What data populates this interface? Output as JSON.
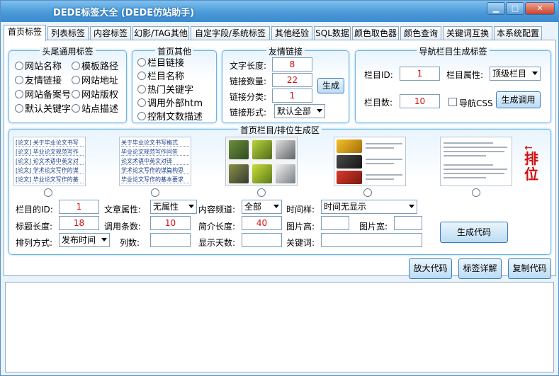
{
  "window": {
    "title": "DEDE标签大全 (DEDE仿站助手)"
  },
  "tabs": [
    "首页标签",
    "列表标签",
    "内容标签",
    "幻影/TAG其他",
    "自定字段/系统标签",
    "其他经验",
    "SQL数据",
    "颜色取色器",
    "颜色查询",
    "关键词互换",
    "本系统配置"
  ],
  "header_tags": {
    "caption": "头尾通用标签",
    "items": [
      "网站名称",
      "模板路径",
      "友情链接",
      "网站地址",
      "网站备案号",
      "网站版权",
      "默认关键字",
      "站点描述"
    ]
  },
  "home_other": {
    "caption": "首页其他",
    "items": [
      "栏目链接",
      "栏目名称",
      "热门关键字",
      "调用外部htm",
      "控制文数描述"
    ]
  },
  "friend_links": {
    "caption": "友情链接",
    "text_length_label": "文字长度:",
    "text_length": "8",
    "link_count_label": "链接数量:",
    "link_count": "22",
    "link_category_label": "链接分类:",
    "link_category": "1",
    "link_form_label": "链接形式:",
    "link_form": "默认全部",
    "generate_label": "生成"
  },
  "nav_tags": {
    "caption": "导航栏目生成标签",
    "column_id_label": "栏目ID:",
    "column_id": "1",
    "column_attr_label": "栏目属性:",
    "column_attr": "顶级栏目",
    "column_count_label": "栏目数:",
    "column_count": "10",
    "nav_css_label": "导航CSS",
    "generate_call_label": "生成调用"
  },
  "home_column": {
    "caption": "首页栏目/排位生成区",
    "list_lines_a": [
      "[论文] 关于毕业论文书写",
      "[论文] 毕业论文规范写作",
      "[论文] 论文术语中英文对",
      "[论文] 学术论文写作的谋",
      "[论文] 毕业论文写作的基"
    ],
    "list_lines_b": [
      "关于毕业论文书写格式",
      "毕业论文规范写作问答",
      "论文术语中英文对译",
      "学术论文写作的谋篇构思",
      "毕业论文写作的基本要求"
    ],
    "side_label": "排位",
    "column_id_label": "栏目的ID:",
    "column_id": "1",
    "article_attr_label": "文章属性:",
    "article_attr": "无属性",
    "channel_label": "内容频道:",
    "channel": "全部",
    "time_style_label": "时间样:",
    "time_style": "时间无显示",
    "title_length_label": "标题长度:",
    "title_length": "18",
    "call_count_label": "调用条数:",
    "call_count": "10",
    "intro_length_label": "简介长度:",
    "intro_length": "40",
    "img_height_label": "图片高:",
    "img_height": "",
    "img_width_label": "图片宽:",
    "img_width": "",
    "sort_label": "排列方式:",
    "sort": "发布时间",
    "columns_label": "列数:",
    "columns": "",
    "show_days_label": "显示天数:",
    "show_days": "",
    "keyword_label": "关键词:",
    "keyword": "",
    "generate_code_label": "生成代码"
  },
  "actions": {
    "enlarge_label": "放大代码",
    "tag_detail_label": "标签详解",
    "copy_label": "复制代码"
  },
  "output": {
    "value": ""
  },
  "colors": {
    "accent": "#3b8ad0",
    "value_text": "#d01010",
    "side_text": "#d01010"
  }
}
